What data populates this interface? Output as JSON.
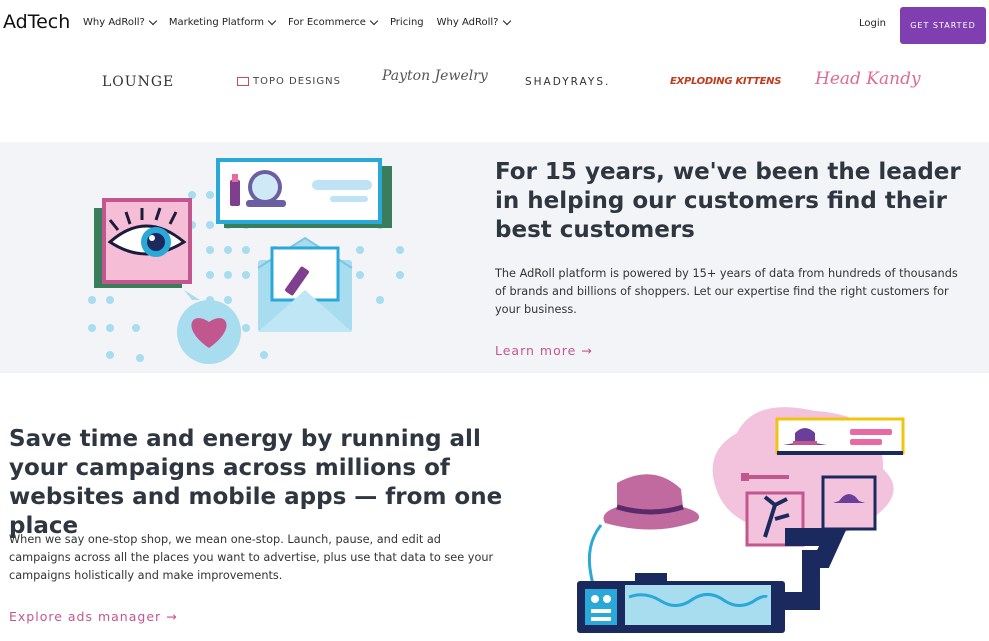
{
  "nav": {
    "logo": "AdTech",
    "menu": [
      "Why AdRoll?",
      "Marketing Platform",
      "For Ecommerce",
      "Pricing",
      "Why AdRoll?"
    ],
    "login": "Login",
    "cta": "GET STARTED"
  },
  "logos": {
    "lounge": "LOUNGE",
    "topo": "TOPO DESIGNS",
    "payton": "Payton Jewelry",
    "shady": "SHADYRAYS.",
    "kittens": "EXPLODING KITTENS",
    "hk": "Head Kandy"
  },
  "section1": {
    "heading": "For 15 years, we've been the leader in helping our customers find their best customers",
    "body": "The AdRoll platform is powered by 15+ years of data from hundreds of thousands of brands and billions of shoppers. Let our expertise find the right customers for your business.",
    "link": "Learn more →"
  },
  "section2": {
    "heading": "Save time and energy by running all your campaigns across millions of websites and mobile apps — from one place",
    "body": "When we say one-stop shop, we mean one-stop. Launch, pause, and edit ad campaigns across all the places you want to advertise, plus use that data to see your campaigns holistically and make improvements.",
    "link": "Explore ads manager →"
  },
  "colors": {
    "cta": "#7f3fb0",
    "link": "#c2578f",
    "section_bg": "#f3f4f7",
    "heading": "#2f3640"
  }
}
